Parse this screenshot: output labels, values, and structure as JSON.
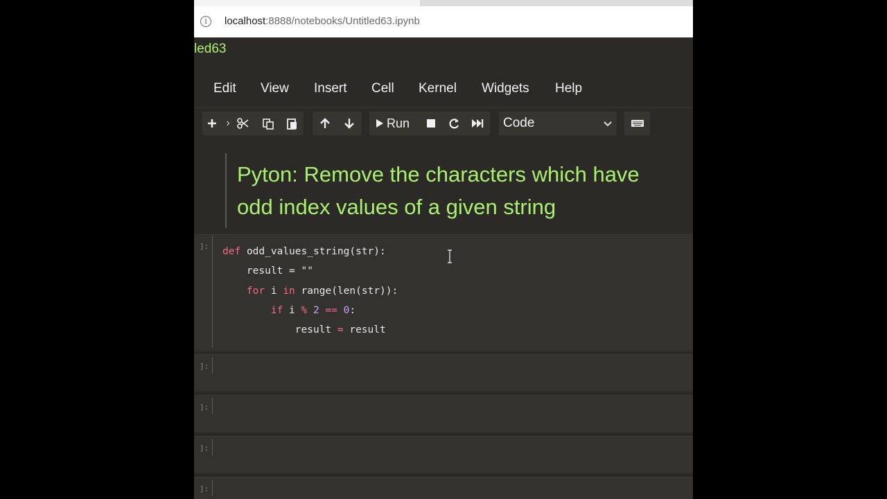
{
  "browser": {
    "url_host": "localhost",
    "url_path": ":8888/notebooks/Untitled63.ipynb"
  },
  "notebook": {
    "title_fragment": "led63"
  },
  "menubar": {
    "items": [
      "Edit",
      "View",
      "Insert",
      "Cell",
      "Kernel",
      "Widgets",
      "Help"
    ]
  },
  "toolbar": {
    "run_label": "Run",
    "cell_type": "Code",
    "partial_glyph": "›"
  },
  "markdown_cell": {
    "text": "Pyton: Remove the characters which have odd index values of a given string"
  },
  "code_cell": {
    "prompt": "]:",
    "lines": [
      "def odd_values_string(str):",
      "    result = \"\"",
      "    for i in range(len(str)):",
      "        if i % 2 == 0:",
      "            result = result"
    ]
  },
  "empty_cells": [
    {
      "prompt": "]:"
    },
    {
      "prompt": "]:"
    },
    {
      "prompt": "]:"
    },
    {
      "prompt": "]:"
    }
  ],
  "colors": {
    "accent_green": "#aaf06e",
    "keyword_pink": "#f36a8a",
    "number_purple": "#c6a3f5",
    "background": "#2b2a27"
  },
  "icons": [
    "info-icon",
    "plus-icon",
    "cut-icon",
    "copy-icon",
    "paste-icon",
    "arrow-up-icon",
    "arrow-down-icon",
    "play-icon",
    "stop-icon",
    "restart-icon",
    "fast-forward-icon",
    "chevron-down-icon",
    "keyboard-icon",
    "text-cursor-icon"
  ]
}
